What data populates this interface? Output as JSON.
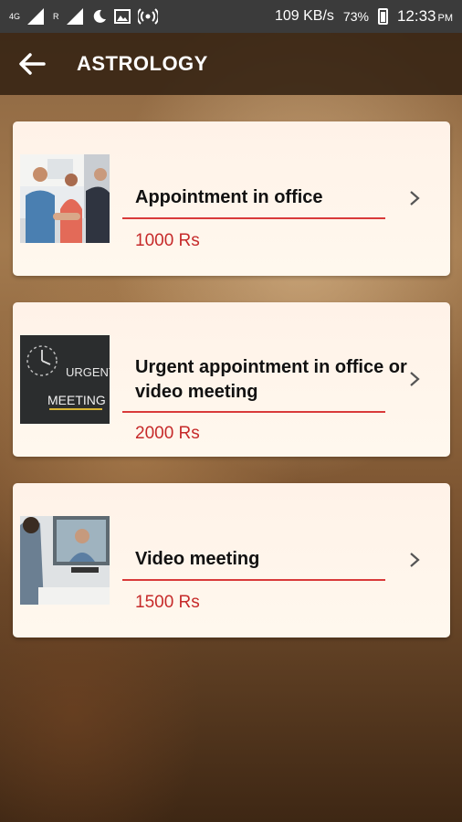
{
  "status": {
    "left_net": "4G",
    "left_roam": "R",
    "speed": "109 KB/s",
    "battery": "73%",
    "time": "12:33",
    "ampm": "PM"
  },
  "header": {
    "title": "ASTROLOGY"
  },
  "cards": [
    {
      "title": "Appointment in office",
      "price": "1000 Rs"
    },
    {
      "title": "Urgent appointment in office or video meeting",
      "price": "2000 Rs",
      "image_text_1": "URGENT",
      "image_text_2": "MEETING"
    },
    {
      "title": "Video meeting",
      "price": "1500 Rs"
    }
  ],
  "colors": {
    "accent_red": "#d93a3a",
    "price_red": "#c62a2a",
    "app_bar": "#342212"
  }
}
